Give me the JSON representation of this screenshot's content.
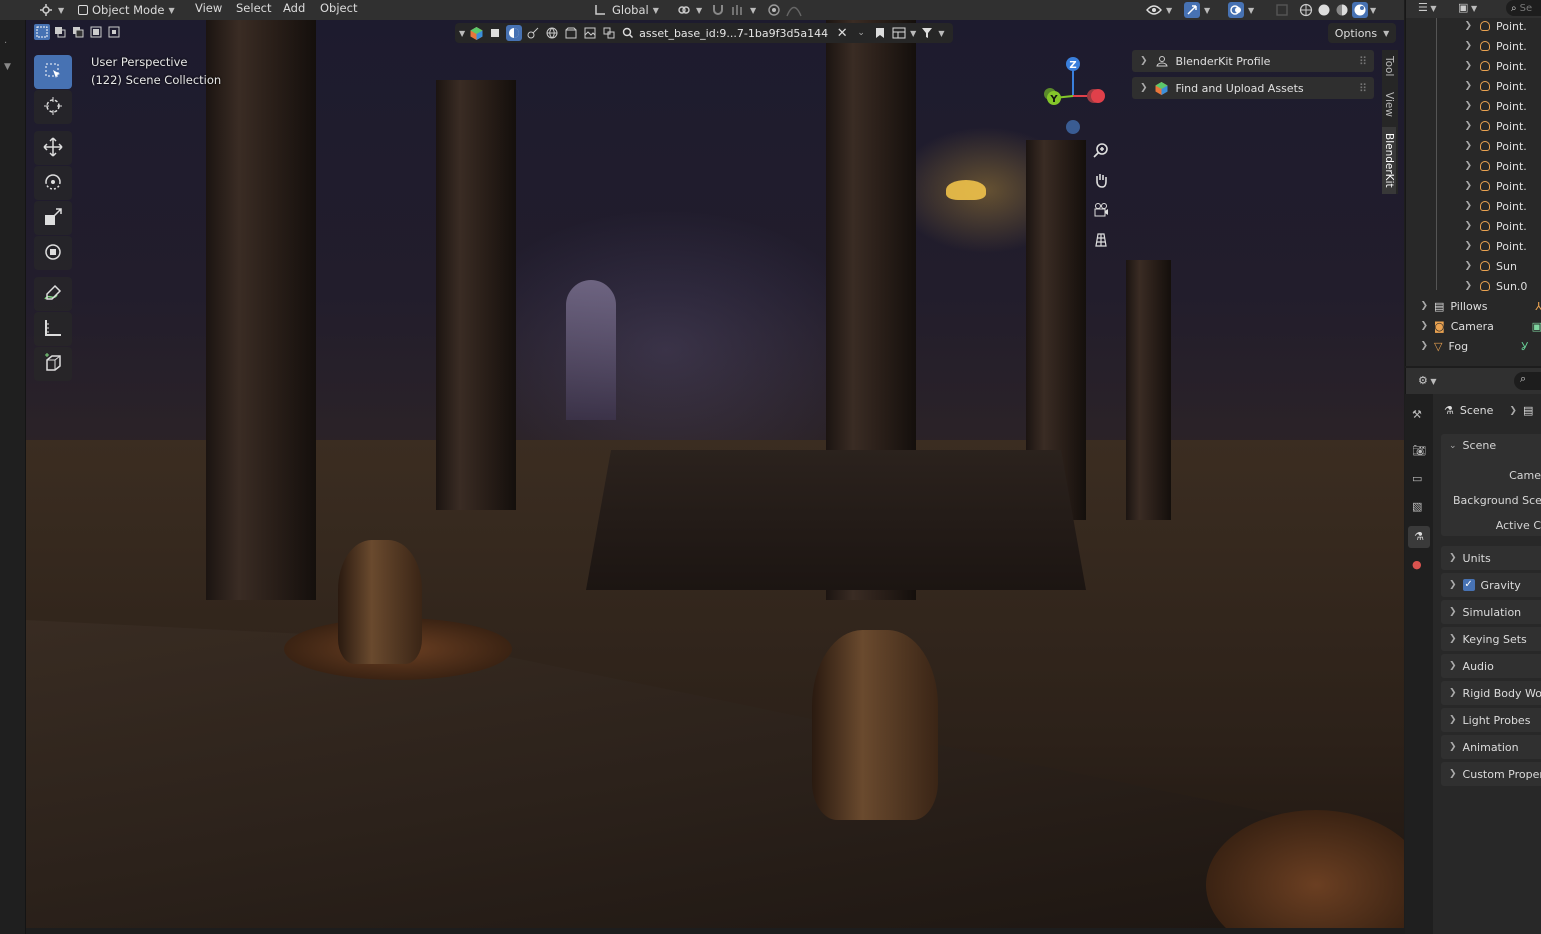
{
  "header": {
    "mode": "Object Mode",
    "menus": [
      "View",
      "Select",
      "Add",
      "Object"
    ],
    "transform_orientation": "Global"
  },
  "viewport": {
    "perspective": "User Perspective",
    "collection": "(122) Scene Collection",
    "search_value": "asset_base_id:9...7-1ba9f3d5a144",
    "options_label": "Options"
  },
  "npanel": {
    "panels": [
      "BlenderKit Profile",
      "Find and Upload Assets"
    ],
    "tabs": [
      "Tool",
      "View",
      "BlenderKit"
    ]
  },
  "gizmo": {
    "x": "X",
    "y": "Y",
    "z": "Z"
  },
  "outliner": {
    "rows": [
      "Point.",
      "Point.",
      "Point.",
      "Point.",
      "Point.",
      "Point.",
      "Point.",
      "Point.",
      "Point.",
      "Point.",
      "Point.",
      "Point.",
      "Sun",
      "Sun.0"
    ],
    "collections": [
      "Pillows",
      "Camera",
      "Fog"
    ],
    "search_placeholder": "Se"
  },
  "properties": {
    "breadcrumb": "Scene",
    "panel_title": "Scene",
    "fields": [
      "Came",
      "Background Sce",
      "Active C"
    ],
    "sections": [
      "Units",
      "Gravity",
      "Simulation",
      "Keying Sets",
      "Audio",
      "Rigid Body Wo",
      "Light Probes",
      "Animation",
      "Custom Proper"
    ]
  },
  "colors": {
    "accent": "#4772b3",
    "x_axis": "#e0404a",
    "y_axis": "#84c62a",
    "z_axis": "#3a7fdb",
    "lamp": "#e9a251"
  }
}
